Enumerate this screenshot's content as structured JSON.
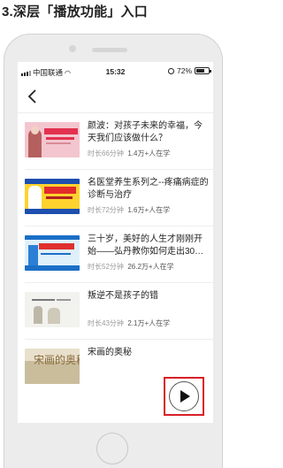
{
  "heading": "3.深层「播放功能」入口",
  "statusbar": {
    "carrier": "中国联通",
    "time": "15:32",
    "battery": "72%"
  },
  "nav": {
    "back_icon": "chevron-left-icon"
  },
  "courses": [
    {
      "title": "颜波：对孩子未来的幸福，今天我们应该做什么？",
      "duration": "时长66分钟",
      "learners": "1.4万+人在学"
    },
    {
      "title": "名医堂养生系列之--疼痛病症的诊断与治疗",
      "duration": "时长72分钟",
      "learners": "1.6万+人在学"
    },
    {
      "title": "三十岁，美好的人生才刚刚开始——弘丹教你如何走出30…",
      "duration": "时长52分钟",
      "learners": "26.2万+人在学"
    },
    {
      "title": "叛逆不是孩子的错",
      "duration": "时长43分钟",
      "learners": "2.1万+人在学"
    },
    {
      "title": "宋画的奥秘",
      "duration": "",
      "learners": ""
    }
  ],
  "thumbnails": {
    "item5_text": "宋画的奥秘"
  },
  "play_button": {
    "icon": "play-icon",
    "highlight_color": "#d81f26"
  }
}
